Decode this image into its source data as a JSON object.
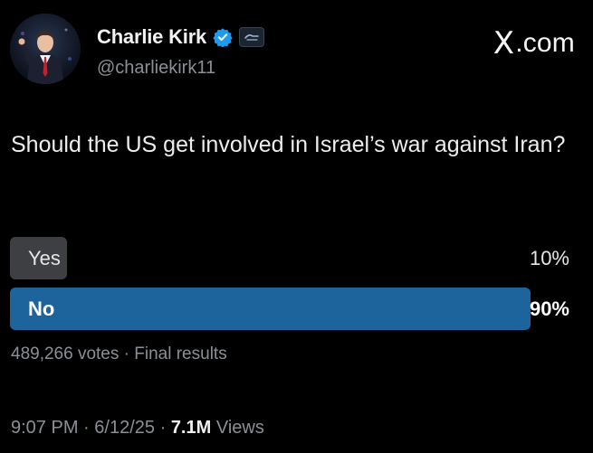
{
  "author": {
    "display_name": "Charlie Kirk",
    "handle": "@charliekirk11",
    "avatar_icon": "profile-photo-avatar",
    "verified_icon": "verified-badge-icon",
    "affiliate_icon": "affiliate-badge-icon",
    "verified_color": "#1d9bf0"
  },
  "watermark": {
    "logo": "X",
    "suffix": ".com"
  },
  "post": {
    "question": "Should the US get involved in Israel’s war against Iran?"
  },
  "poll": {
    "options": [
      {
        "label": "Yes",
        "percent_text": "10%",
        "percent": 10
      },
      {
        "label": "No",
        "percent_text": "90%",
        "percent": 90,
        "winner": true
      }
    ],
    "votes": "489,266 votes",
    "separator": "·",
    "status": "Final results",
    "winner_color": "#1d639c",
    "loser_color": "#3d3f42"
  },
  "meta": {
    "time": "9:07 PM",
    "date": "6/12/25",
    "separator": "·",
    "views_count": "7.1M",
    "views_label": "Views"
  }
}
